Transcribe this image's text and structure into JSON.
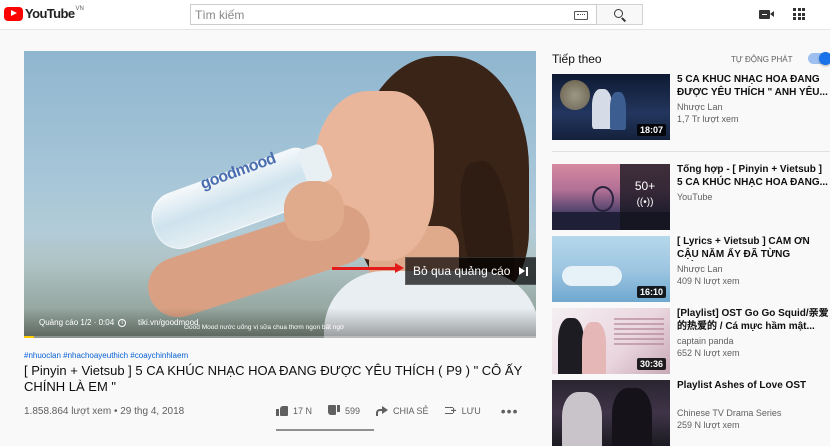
{
  "header": {
    "logo_text": "YouTube",
    "logo_country": "VN",
    "search_placeholder": "Tìm kiếm"
  },
  "player": {
    "ad_counter": "Quảng cáo 1/2 · 0:04",
    "ad_url": "tiki.vn/goodmood",
    "ad_slogan": "Good Mood nước uống vị sữa chua thơm ngon bất ngờ",
    "bottle_brand": "goodmood",
    "skip_label": "Bỏ qua quảng cáo",
    "ad_progress": 0.02
  },
  "video": {
    "hashtags": "#nhuoclan #nhachoayeuthich #coaychinhlaem",
    "title": "[ Pinyin + Vietsub ] 5 CA KHÚC NHẠC HOA ĐANG ĐƯỢC YÊU THÍCH ( P9 ) \" CÔ ẤY CHÍNH LÀ EM \"",
    "stats": "1.858.864 lượt xem • 29 thg 4, 2018",
    "likes": "17 N",
    "dislikes": "599",
    "share_label": "CHIA SẺ",
    "save_label": "LƯU"
  },
  "sidebar": {
    "up_next": "Tiếp theo",
    "autoplay_label": "TỰ ĐỘNG PHÁT",
    "autoplay_on": true,
    "items": [
      {
        "title": "5 CA KHÚC NHẠC HOA ĐANG ĐƯỢC YÊU THÍCH \" ANH YÊU...",
        "channel": "Nhược Lan",
        "views": "1,7 Tr lượt xem",
        "duration": "18:07"
      },
      {
        "title": "Tổng hợp - [ Pinyin + Vietsub ] 5 CA KHÚC NHẠC HOA ĐANG...",
        "channel": "YouTube",
        "views": "",
        "mix_count": "50+"
      },
      {
        "title": "[ Lyrics + Vietsub ] CẢM ƠN CẬU NĂM ẤY ĐÃ TỪNG THÍCH...",
        "channel": "Nhược Lan",
        "views": "409 N lượt xem",
        "duration": "16:10"
      },
      {
        "title": "[Playlist] OST Go Go Squid/亲爱的热爱的 / Cá mực hầm mật...",
        "channel": "captain panda",
        "views": "652 N lượt xem",
        "duration": "30:36"
      },
      {
        "title": "Playlist Ashes of Love OST",
        "channel": "Chinese TV Drama Series",
        "views": "259 N lượt xem",
        "duration": ""
      }
    ]
  },
  "colors": {
    "brand_red": "#ff0000",
    "link_blue": "#065fd4",
    "toggle_blue": "#1a73e8",
    "ad_yellow": "#ffcc00",
    "arrow_red": "#e31b1b"
  }
}
